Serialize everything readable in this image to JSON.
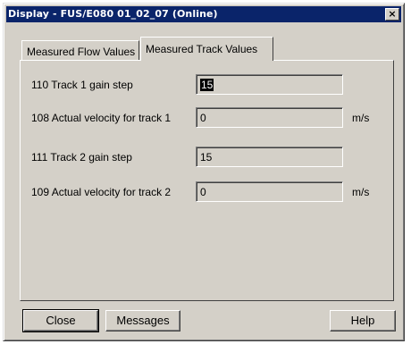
{
  "window": {
    "title": "Display - FUS/E080 01_02_07  (Online)",
    "close_glyph": "×"
  },
  "tabs": [
    {
      "label": "Measured Flow Values",
      "active": false
    },
    {
      "label": "Measured Track Values",
      "active": true
    }
  ],
  "fields": [
    {
      "label": "110  Track 1 gain step",
      "value": "15",
      "unit": ""
    },
    {
      "label": "108  Actual velocity for track 1",
      "value": "0",
      "unit": "m/s"
    },
    {
      "label": "111  Track 2 gain step",
      "value": "15",
      "unit": ""
    },
    {
      "label": "109  Actual velocity for track 2",
      "value": "0",
      "unit": "m/s"
    }
  ],
  "buttons": {
    "close": "Close",
    "messages": "Messages",
    "help": "Help"
  },
  "colors": {
    "titlebar": "#0a246a",
    "face": "#d4d0c8"
  }
}
